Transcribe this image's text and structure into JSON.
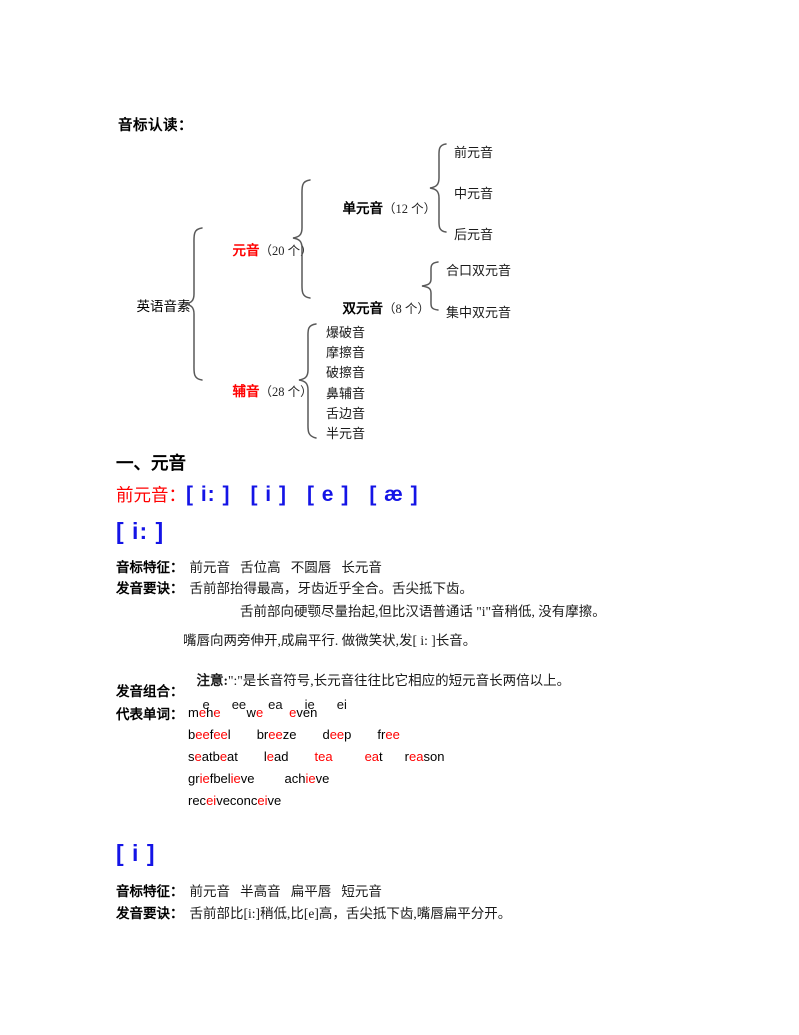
{
  "document": {
    "title": "音标认读："
  },
  "tree": {
    "root": "英语音素",
    "branches": [
      {
        "label": "元音",
        "count": "（20 个）",
        "children": [
          {
            "label": "单元音",
            "count": "（12 个）",
            "leaves": [
              "前元音",
              "中元音",
              "后元音"
            ]
          },
          {
            "label": "双元音",
            "count": "（8 个）",
            "leaves": [
              "合口双元音",
              "集中双元音"
            ]
          }
        ]
      },
      {
        "label": "辅音",
        "count": "（28 个）",
        "leaves": [
          "爆破音",
          "摩擦音",
          "破擦音",
          "鼻辅音",
          "舌边音",
          "半元音"
        ]
      }
    ]
  },
  "colors": {
    "red": "#ff0000",
    "blue": "#1414e6",
    "text": "#000000"
  },
  "sections": {
    "vowel_heading": "一、元音",
    "front_vowel_label": "前元音：",
    "front_vowel_symbols": [
      "[ i: ]",
      "[ i ]",
      "[ e ]",
      "[ æ ]"
    ]
  },
  "phonemes": [
    {
      "symbol": "[ i: ]",
      "feature_key": "音标特征：",
      "feature_value": "前元音   舌位高   不圆唇   长元音",
      "tip_key": "发音要诀：",
      "tip_value": "舌前部抬得最高，牙齿近乎全合。舌尖抵下齿。",
      "tip_extra": [
        "舌前部向硬颚尽量抬起,但比汉语普通话 \"i\"音稍低, 没有摩擦。",
        "嘴唇向两旁伸开,成扁平行. 做微笑状,发[ i: ]长音。"
      ],
      "note_key": "注意:",
      "note_value": "\":\"是长音符号,长元音往往比它相应的短元音长两倍以上。",
      "combo_key": "发音组合：",
      "combos": [
        "e",
        "ee",
        "ea",
        "ie",
        "ei"
      ],
      "words_key": "代表单词：",
      "word_rows": [
        [
          {
            "pre": "m",
            "hl": "e",
            "post": ""
          },
          {
            "pre": "h",
            "hl": "e",
            "post": ""
          },
          {
            "pre": "w",
            "hl": "e",
            "post": ""
          },
          {
            "pre": "",
            "hl": "e",
            "post": "ven"
          }
        ],
        [
          {
            "pre": "b",
            "hl": "ee",
            "post": ""
          },
          {
            "pre": "f",
            "hl": "ee",
            "post": "l"
          },
          {
            "pre": "br",
            "hl": "ee",
            "post": "ze"
          },
          {
            "pre": "d",
            "hl": "ee",
            "post": "p"
          },
          {
            "pre": "fr",
            "hl": "ee",
            "post": ""
          }
        ],
        [
          {
            "pre": "s",
            "hl": "e",
            "post": "at"
          },
          {
            "pre": "b",
            "hl": "e",
            "post": "at"
          },
          {
            "pre": "l",
            "hl": "e",
            "post": "ad"
          },
          {
            "pre": "",
            "hl": "tea",
            "post": ""
          },
          {
            "pre": "",
            "hl": "ea",
            "post": "t"
          },
          {
            "pre": "r",
            "hl": "ea",
            "post": "son"
          }
        ],
        [
          {
            "pre": "gr",
            "hl": "ie",
            "post": "f"
          },
          {
            "pre": "bel",
            "hl": "ie",
            "post": "ve"
          },
          {
            "pre": "ach",
            "hl": "ie",
            "post": "ve"
          }
        ],
        [
          {
            "pre": "rec",
            "hl": "ei",
            "post": "ve"
          },
          {
            "pre": "conc",
            "hl": "ei",
            "post": "ve"
          }
        ]
      ]
    },
    {
      "symbol": "[ i ]",
      "feature_key": "音标特征：",
      "feature_value": "前元音   半高音   扁平唇   短元音",
      "tip_key": "发音要诀：",
      "tip_value": "舌前部比[i:]稍低,比[e]高，舌尖抵下齿,嘴唇扁平分开。"
    }
  ]
}
